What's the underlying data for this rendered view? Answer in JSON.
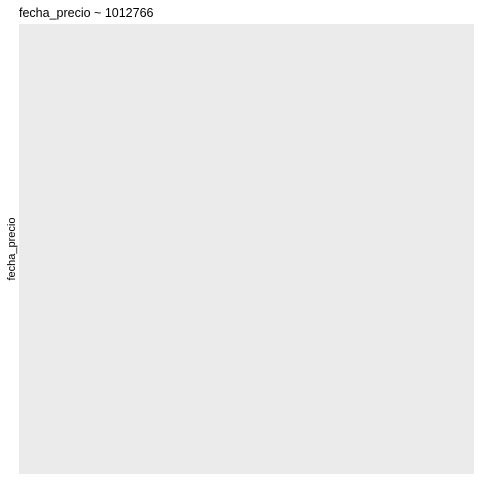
{
  "chart_data": {
    "type": "scatter",
    "title": "fecha_precio ~ 1012766",
    "xlabel": "",
    "ylabel": "fecha_precio",
    "series": [],
    "grid": false,
    "colors": {
      "panel_background": "#ebebeb",
      "page_background": "#ffffff",
      "text": "#000000"
    }
  }
}
